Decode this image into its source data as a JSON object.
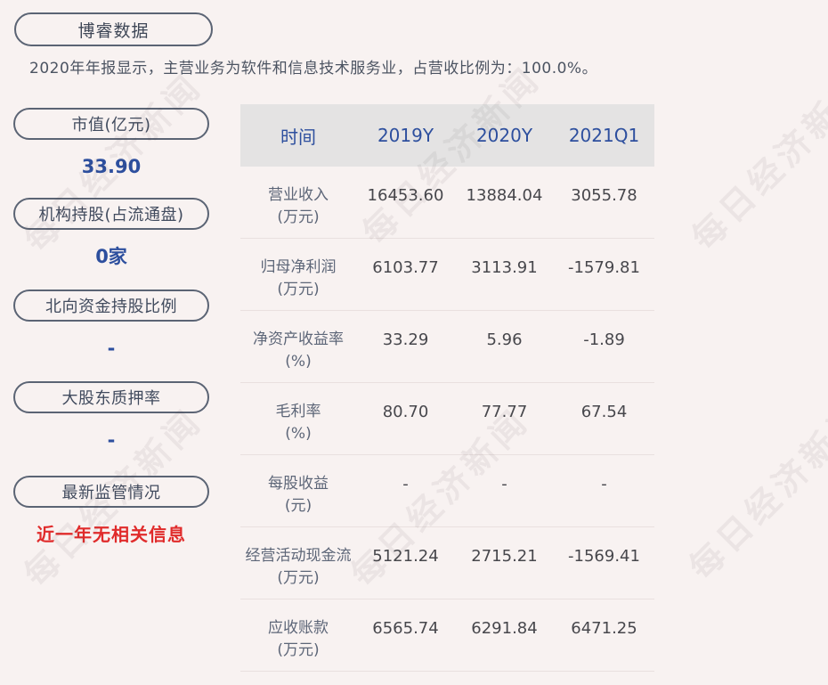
{
  "watermark": {
    "text": "每日经济新闻"
  },
  "header": {
    "company_name": "博睿数据",
    "subtitle": "2020年年报显示，主营业务为软件和信息技术服务业，占营收比例为：100.0%。"
  },
  "sidebar": {
    "items": [
      {
        "label": "市值(亿元)",
        "value": "33.90",
        "style": "blue"
      },
      {
        "label": "机构持股(占流通盘)",
        "value": "0家",
        "style": "blue"
      },
      {
        "label": "北向资金持股比例",
        "value": "-",
        "style": "blue"
      },
      {
        "label": "大股东质押率",
        "value": "-",
        "style": "blue"
      },
      {
        "label": "最新监管情况",
        "value": "近一年无相关信息",
        "style": "red"
      }
    ]
  },
  "table": {
    "columns": [
      "时间",
      "2019Y",
      "2020Y",
      "2021Q1"
    ],
    "rows": [
      {
        "name": "营业收入",
        "unit": "(万元)",
        "values": [
          "16453.60",
          "13884.04",
          "3055.78"
        ]
      },
      {
        "name": "归母净利润",
        "unit": "(万元)",
        "values": [
          "6103.77",
          "3113.91",
          "-1579.81"
        ]
      },
      {
        "name": "净资产收益率",
        "unit": "(%)",
        "values": [
          "33.29",
          "5.96",
          "-1.89"
        ]
      },
      {
        "name": "毛利率",
        "unit": "(%)",
        "values": [
          "80.70",
          "77.77",
          "67.54"
        ]
      },
      {
        "name": "每股收益",
        "unit": "(元)",
        "values": [
          "-",
          "-",
          "-"
        ]
      },
      {
        "name": "经营活动现金流",
        "unit": "(万元)",
        "values": [
          "5121.24",
          "2715.21",
          "-1569.41"
        ]
      },
      {
        "name": "应收账款",
        "unit": "(万元)",
        "values": [
          "6565.74",
          "6291.84",
          "6471.25"
        ]
      }
    ]
  },
  "colors": {
    "page-bg": "#f8f2f1",
    "accent-blue": "#2d4f9e",
    "alert-red": "#e02b2b",
    "pill-border": "#5b6474",
    "pill-text": "#414b5e",
    "table-header-bg": "#e4e3e3",
    "table-label": "#5d6678",
    "table-value": "#47474c",
    "divider": "#e9e0df"
  }
}
